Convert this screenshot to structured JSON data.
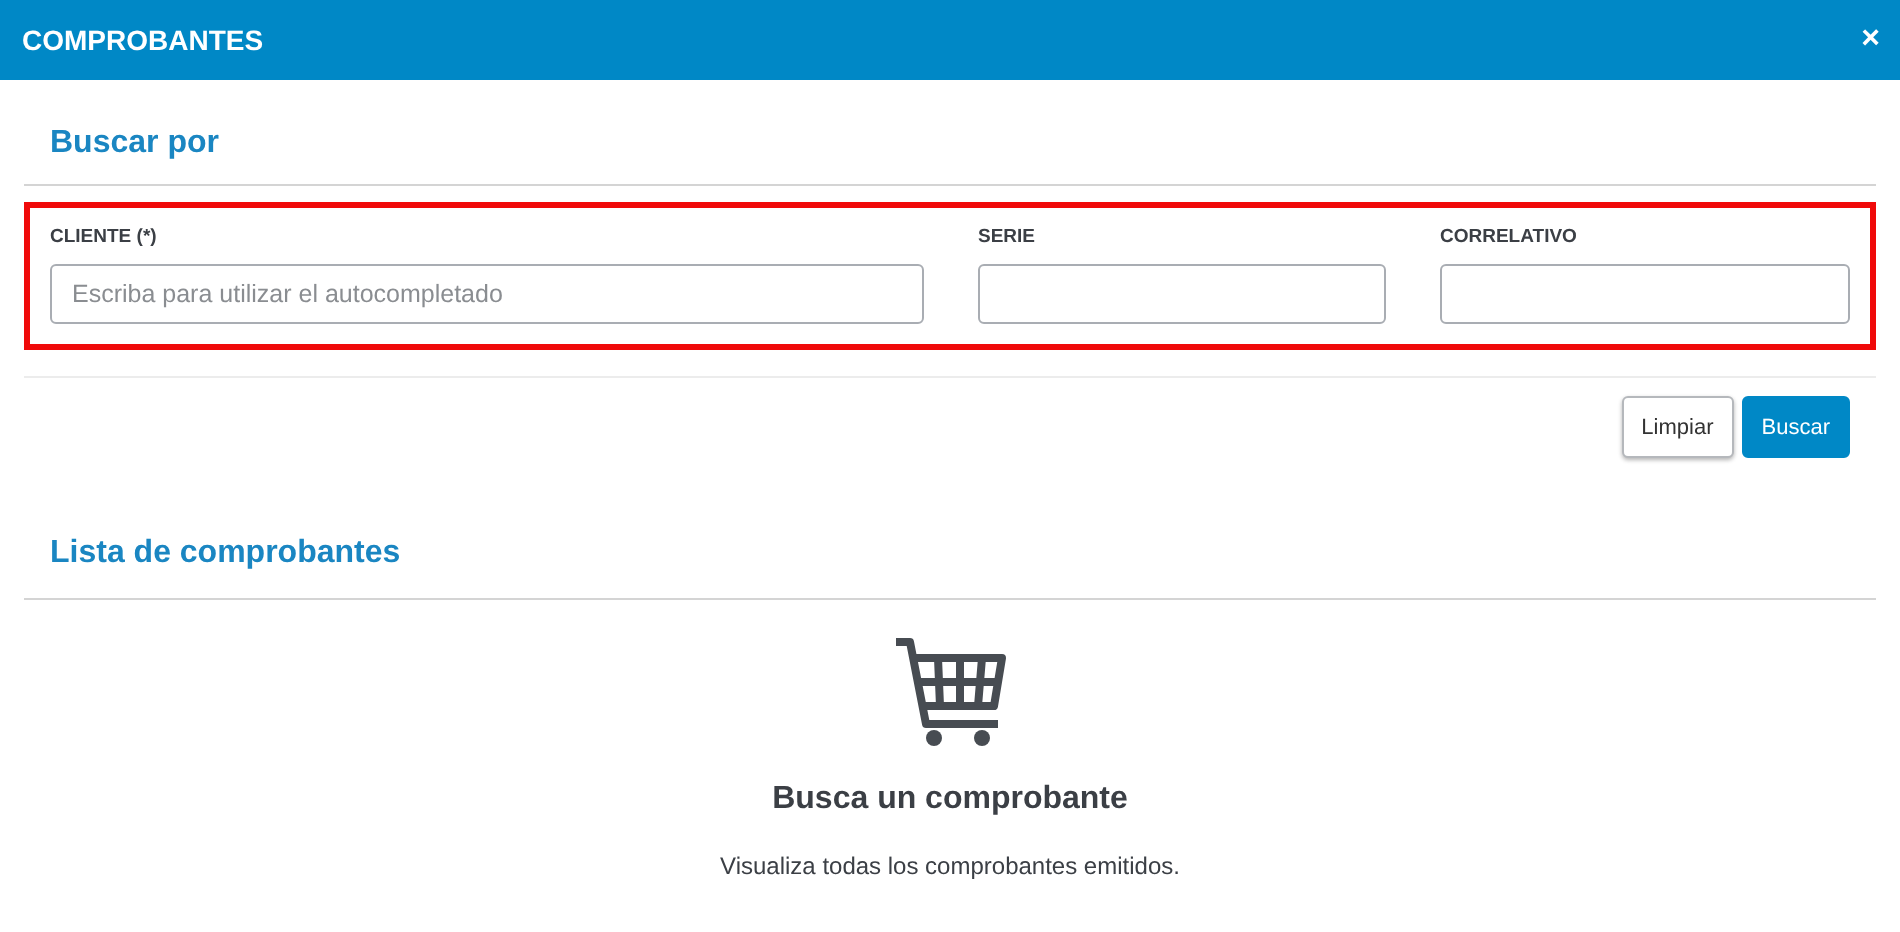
{
  "window": {
    "title": "COMPROBANTES",
    "close": "×"
  },
  "search": {
    "heading": "Buscar por",
    "fields": [
      {
        "label": "CLIENTE (*)",
        "placeholder": "Escriba para utilizar el autocompletado"
      },
      {
        "label": "SERIE"
      },
      {
        "label": "CORRELATIVO"
      }
    ],
    "buttons": [
      {
        "label": "Limpiar",
        "kind": "secondary"
      },
      {
        "label": "Buscar",
        "kind": "primary"
      }
    ]
  },
  "list": {
    "heading": "Lista de comprobantes",
    "empty_title": "Busca un comprobante",
    "empty_text": "Visualiza todas los comprobantes emitidos."
  }
}
